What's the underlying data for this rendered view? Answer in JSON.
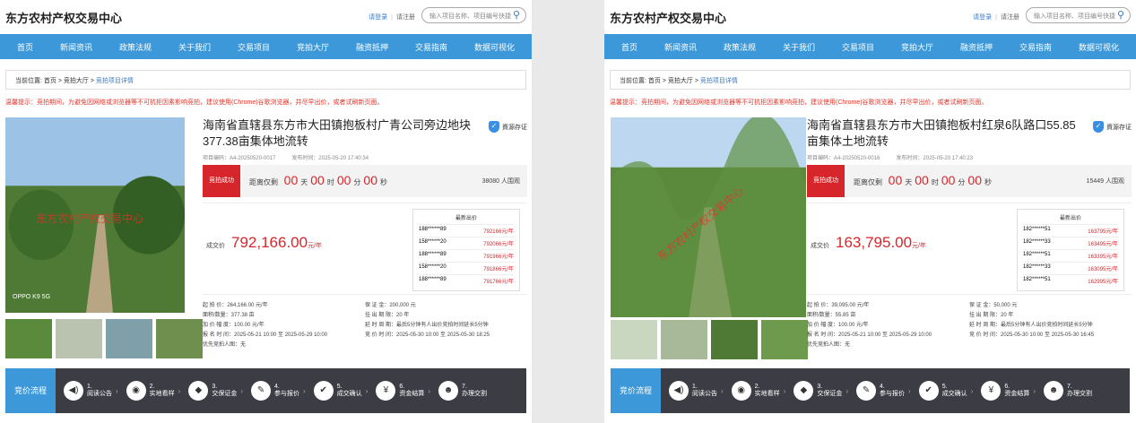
{
  "site": {
    "logo": "东方农村产权交易中心",
    "login": "请登录",
    "register": "请注册",
    "search_placeholder": "输入项目名称、项目编号快捷"
  },
  "nav": [
    "首页",
    "新闻资讯",
    "政策法规",
    "关于我们",
    "交易项目",
    "竞拍大厅",
    "融资抵押",
    "交易指南",
    "数据可视化"
  ],
  "crumb": {
    "label": "当前位置:",
    "home": "首页",
    "hall": "竞拍大厅",
    "current": "竞拍项目详情"
  },
  "warning": "温馨提示：竞拍期间，为避免因网络或浏览器等不可抗拒因素影响竞拍，建议使用(Chrome)谷歌浏览器，并尽早出价，或者试刷新页面。",
  "badge": "資源存证",
  "flow": {
    "header": "竞价流程",
    "steps": [
      {
        "num": "1.",
        "label": "阅读公告",
        "icon": "speaker-icon",
        "glyph": "◀)"
      },
      {
        "num": "2.",
        "label": "实地看样",
        "icon": "eye-icon",
        "glyph": "◉"
      },
      {
        "num": "3.",
        "label": "交保证金",
        "icon": "shield-icon",
        "glyph": "◆"
      },
      {
        "num": "4.",
        "label": "参与报价",
        "icon": "edit-icon",
        "glyph": "✎"
      },
      {
        "num": "5.",
        "label": "成交确认",
        "icon": "confirm-icon",
        "glyph": "✔"
      },
      {
        "num": "6.",
        "label": "资金结算",
        "icon": "money-icon",
        "glyph": "¥"
      },
      {
        "num": "7.",
        "label": "办理交割",
        "icon": "user-icon",
        "glyph": "☻"
      }
    ]
  },
  "left": {
    "title": "海南省直辖县东方市大田镇抱板村广青公司旁边地块377.38亩集体地流转",
    "code": "项目编码：A4-20250520-0017",
    "time": "发布时间：2025-05-20 17:40:34",
    "status": "竞拍成功",
    "countdown_prefix": "距离仅剩",
    "d": "00",
    "h": "00",
    "m": "00",
    "s": "00",
    "watchers": "38080 人围观",
    "deal_label": "成交价",
    "deal_price": "792,166.00",
    "unit": "元/年",
    "bids_title": "最新出价",
    "bids": [
      [
        "188******89",
        "792166元/年"
      ],
      [
        "158******20",
        "792066元/年"
      ],
      [
        "188******89",
        "791966元/年"
      ],
      [
        "158******20",
        "791866元/年"
      ],
      [
        "188******89",
        "791766元/年"
      ]
    ],
    "terms": [
      "起  拍  价：264,166.00 元/年",
      "保  证  金：200,000 元",
      "面积/数量：377.38 亩",
      "挂 出 期 限：20 年",
      "加 价 幅 度：100.00 元/年",
      "延 时 周 期：最后5分钟有人出价竞拍时间延长5分钟",
      "报 名 时 间：2025-05-21 10:00 至 2025-05-29 10:00",
      "竞 价 时 间：2025-05-30 10:00 至 2025-05-30 18:25",
      "优先竞拍人图：无",
      ""
    ],
    "watermark": "东方农村产权交易中心",
    "photo_caption": "OPPO K9 5G"
  },
  "right": {
    "title": "海南省直辖县东方市大田镇抱板村红泉6队路口55.85亩集体土地流转",
    "code": "项目编码：A4-20250520-0016",
    "time": "发布时间：2025-05-20 17:40:23",
    "status": "竞拍成功",
    "countdown_prefix": "距离仅剩",
    "d": "00",
    "h": "00",
    "m": "00",
    "s": "00",
    "watchers": "15449 人围观",
    "deal_label": "成交价",
    "deal_price": "163,795.00",
    "unit": "元/年",
    "bids_title": "最新出价",
    "bids": [
      [
        "182******51",
        "163795元/年"
      ],
      [
        "182******33",
        "163495元/年"
      ],
      [
        "182******51",
        "163395元/年"
      ],
      [
        "182******33",
        "163095元/年"
      ],
      [
        "182******51",
        "162995元/年"
      ]
    ],
    "terms": [
      "起  拍  价：39,095.00 元/年",
      "保  证  金：50,000 元",
      "面积/数量：55.85 亩",
      "挂 出 期 限：20 年",
      "加 价 幅 度：100.00 元/年",
      "延 时 周 期：最后5分钟有人出价竞拍时间延长5分钟",
      "报 名 时 间：2025-05-21 10:00 至 2025-05-29 10:00",
      "竞 价 时 间：2025-05-30 10:00 至 2025-05-30 16:45",
      "优先竞拍人图：无",
      ""
    ],
    "watermark": "东方农村产权交易中心"
  },
  "colors": {
    "accent": "#3c98d8",
    "price": "#d6262b",
    "flow_bg": "#3c3c44"
  },
  "units": {
    "day": "天",
    "hour": "时",
    "min": "分",
    "sec": "秒"
  }
}
